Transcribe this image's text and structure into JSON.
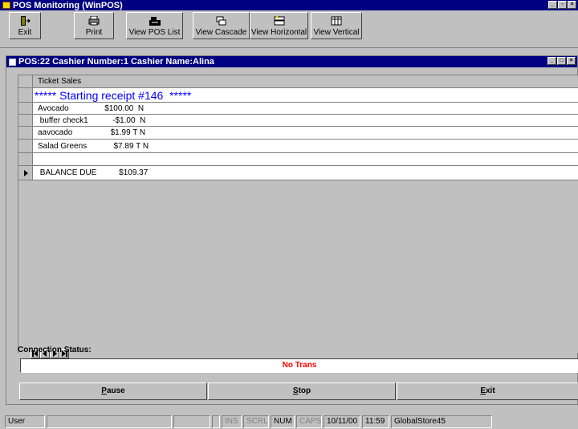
{
  "app": {
    "title": "POS Monitoring (WinPOS)"
  },
  "toolbar": {
    "buttons": [
      {
        "label": "Exit",
        "icon": "exit-door-icon"
      },
      {
        "label": "Print",
        "icon": "printer-icon"
      },
      {
        "label": "View POS List",
        "icon": "pos-register-icon"
      },
      {
        "label": "View Cascade",
        "icon": "cascade-windows-icon"
      },
      {
        "label": "View Horizontal",
        "icon": "tile-horizontal-icon"
      },
      {
        "label": "View Vertical",
        "icon": "tile-vertical-icon"
      }
    ]
  },
  "child_window": {
    "title": "POS:22  Cashier Number:1  Cashier Name:Alina"
  },
  "grid": {
    "header": "Ticket Sales",
    "rows": [
      {
        "text": "***** Starting receipt #146  *****",
        "style": "big",
        "current": false
      },
      {
        "text": "Avocado                $100.00  N",
        "style": "normal",
        "current": false
      },
      {
        "text": " buffer check1           -$1.00  N",
        "style": "normal",
        "current": false
      },
      {
        "text": "aavocado                 $1.99 T N",
        "style": "normal",
        "current": false
      },
      {
        "text": "Salad Greens            $7.89 T N",
        "style": "normal",
        "current": false
      },
      {
        "text": "",
        "style": "normal",
        "current": false
      },
      {
        "text": " BALANCE DUE          $109.37",
        "style": "normal",
        "current": true
      }
    ]
  },
  "connection": {
    "label": "Connection Status:",
    "value": "No Trans",
    "value_color": "#ff0000"
  },
  "actions": {
    "pause": "Pause",
    "stop": "Stop",
    "exit": "Exit"
  },
  "statusbar": {
    "user": "User",
    "ins": "INS",
    "scrl": "SCRL",
    "num": "NUM",
    "caps": "CAPS",
    "date": "10/11/00",
    "time": "11:59",
    "store": "GlobalStore45"
  },
  "colors": {
    "titlebar": "#000080",
    "face": "#c0c0c0",
    "receipt_heading": "#0000ff"
  }
}
